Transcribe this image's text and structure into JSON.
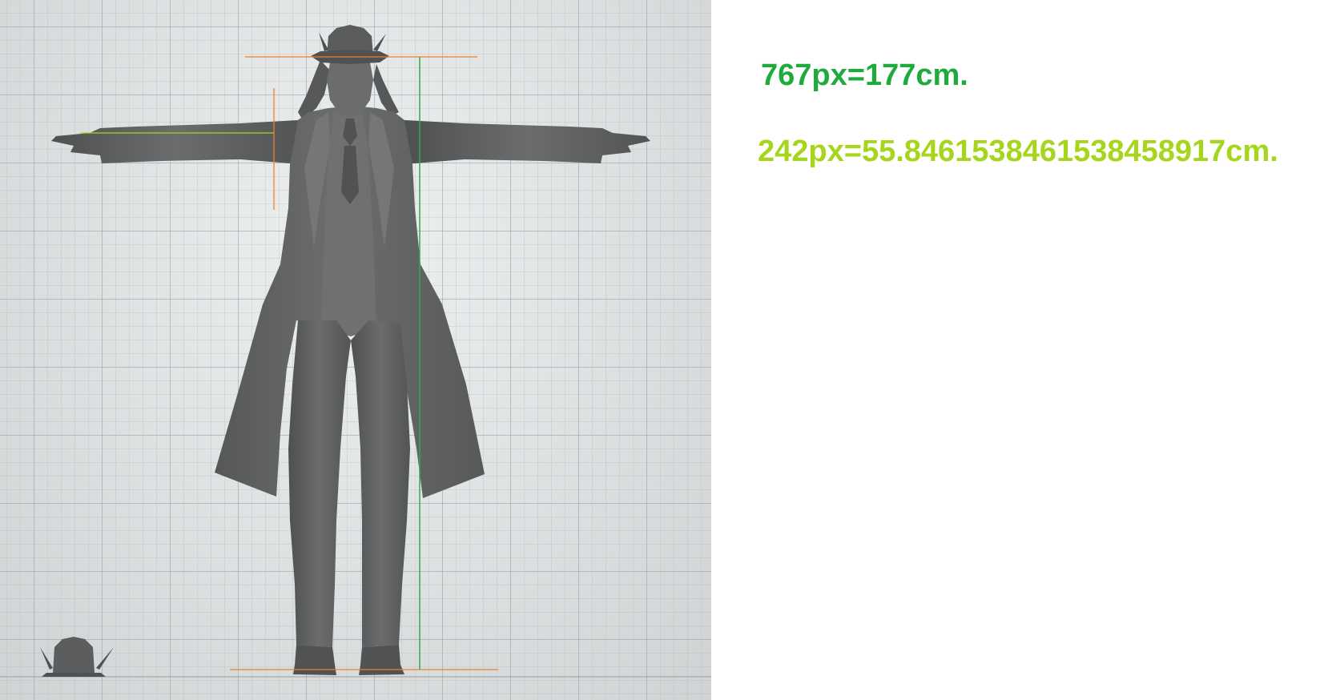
{
  "viewport": {
    "name": "3d-model-front-view",
    "background_color": "#dcdfe0",
    "model_color": "#5f6162"
  },
  "measurement_lines": {
    "orange": "#f07f2a",
    "green": "#2fae45",
    "lime": "#a6d61c"
  },
  "annotations": {
    "height_label": "767px=177cm.",
    "height_color": "#1faa3c",
    "arm_label": "242px=55.8461538461538458917cm.",
    "arm_color": "#a6d61c"
  }
}
